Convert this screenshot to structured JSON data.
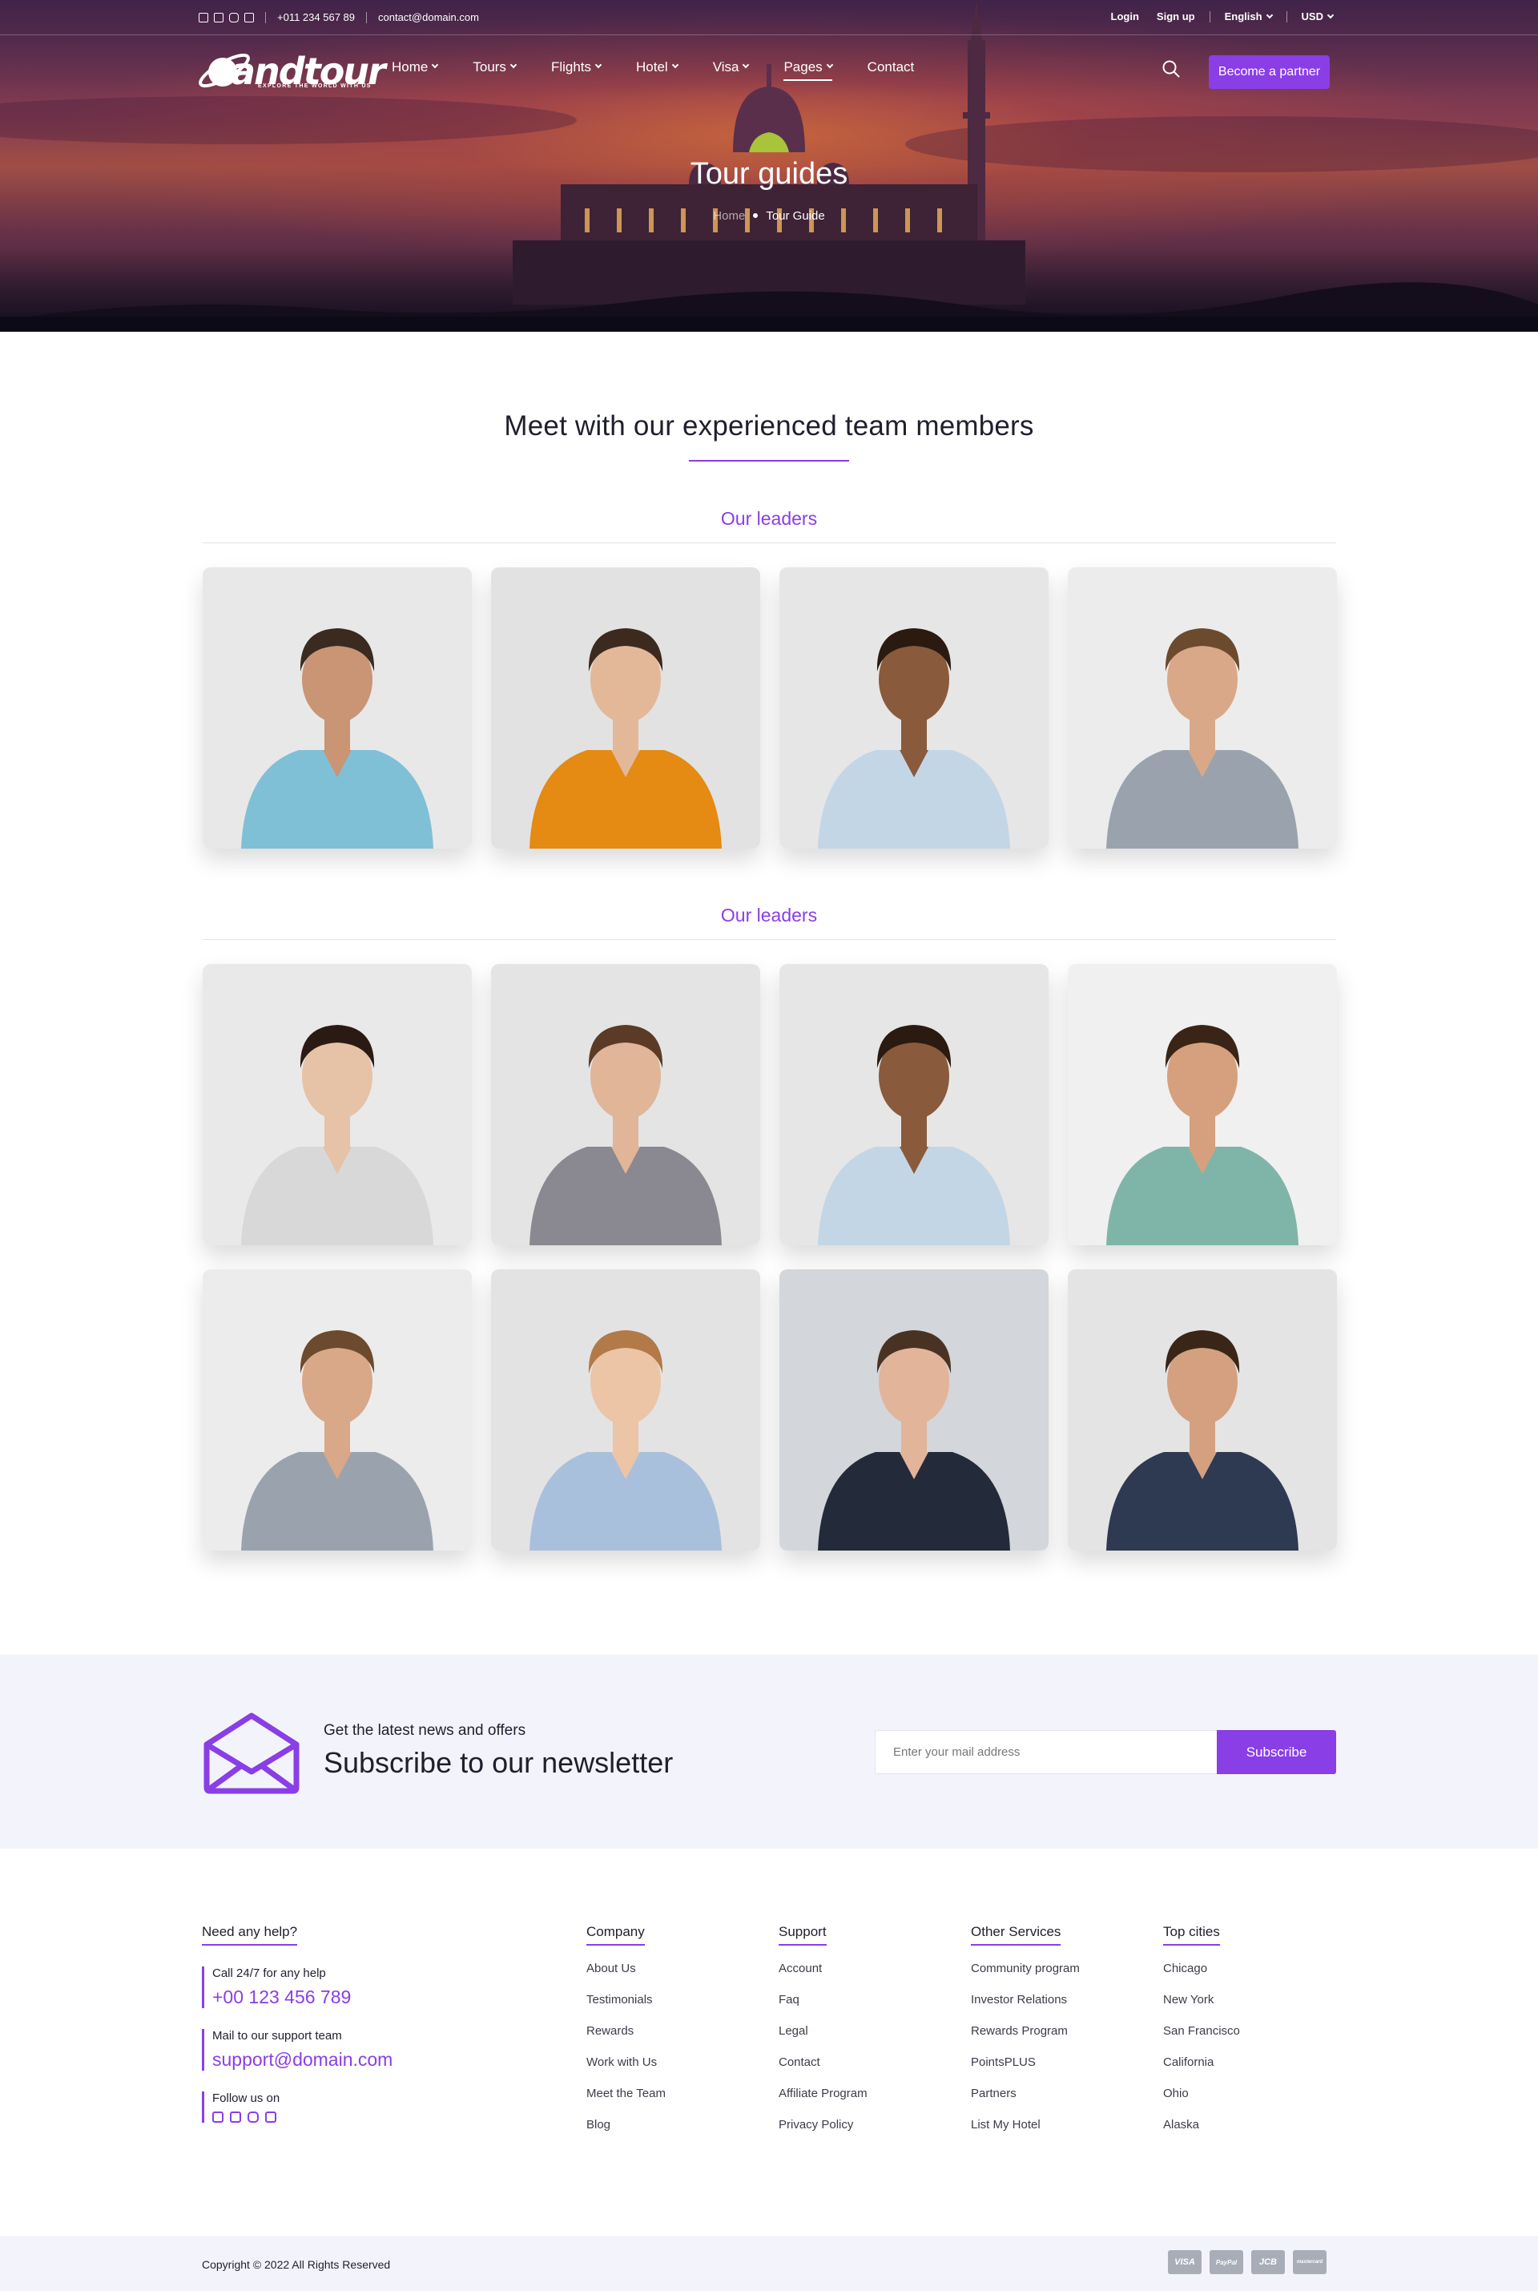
{
  "topbar": {
    "phone": "+011 234 567 89",
    "email": "contact@domain.com",
    "login": "Login",
    "signup": "Sign up",
    "language": "English",
    "currency": "USD"
  },
  "brand": {
    "name": "andtour",
    "tagline": "EXPLORE THE WORLD WITH US"
  },
  "nav": {
    "items": [
      {
        "label": "Home",
        "dropdown": true
      },
      {
        "label": "Tours",
        "dropdown": true
      },
      {
        "label": "Flights",
        "dropdown": true
      },
      {
        "label": "Hotel",
        "dropdown": true
      },
      {
        "label": "Visa",
        "dropdown": true
      },
      {
        "label": "Pages",
        "dropdown": true,
        "active": true
      },
      {
        "label": "Contact",
        "dropdown": false
      }
    ],
    "partner_button": "Become a partner"
  },
  "hero": {
    "title": "Tour guides",
    "breadcrumb_home": "Home",
    "breadcrumb_current": "Tour Guide"
  },
  "team": {
    "heading": "Meet with our experienced team members",
    "groups": [
      {
        "title": "Our leaders",
        "members": [
          {
            "skin": "#c99575",
            "hair": "#3a2a20",
            "shirt": "#7fc0d6",
            "bg": "#e8e8e8"
          },
          {
            "skin": "#e3b899",
            "hair": "#3d2a1e",
            "shirt": "#e58a12",
            "bg": "#e2e2e2"
          },
          {
            "skin": "#8a5a3c",
            "hair": "#2a1a10",
            "shirt": "#c3d6e6",
            "bg": "#e6e6e6"
          },
          {
            "skin": "#d8a888",
            "hair": "#6b4a2e",
            "shirt": "#9aa3ad",
            "bg": "#ececec"
          }
        ]
      },
      {
        "title": "Our leaders",
        "members": [
          {
            "skin": "#e6c2a6",
            "hair": "#2b1a14",
            "shirt": "#d8d8d8",
            "bg": "#e9e9ea"
          },
          {
            "skin": "#e0b598",
            "hair": "#5b3a26",
            "shirt": "#8a8890",
            "bg": "#e4e4e4"
          },
          {
            "skin": "#8a5a3c",
            "hair": "#2a1a10",
            "shirt": "#c3d6e6",
            "bg": "#e6e6e6"
          },
          {
            "skin": "#d6a07e",
            "hair": "#3a2416",
            "shirt": "#7fb5a8",
            "bg": "#f0f0f0"
          },
          {
            "skin": "#d8a888",
            "hair": "#6b4a2e",
            "shirt": "#9aa3ad",
            "bg": "#ececec"
          },
          {
            "skin": "#ecc4a6",
            "hair": "#b27a48",
            "shirt": "#a9c0dc",
            "bg": "#e3e3e3"
          },
          {
            "skin": "#e2b49a",
            "hair": "#4a3222",
            "shirt": "#232a3a",
            "bg": "#d3d6da"
          },
          {
            "skin": "#d4a080",
            "hair": "#3a2616",
            "shirt": "#2d3a52",
            "bg": "#e4e4e4"
          }
        ]
      }
    ]
  },
  "newsletter": {
    "kicker": "Get the latest news and offers",
    "headline": "Subscribe to our newsletter",
    "placeholder": "Enter your mail address",
    "button": "Subscribe"
  },
  "footer": {
    "help": {
      "title": "Need any help?",
      "call_label": "Call 24/7 for any help",
      "call_value": "+00 123 456 789",
      "mail_label": "Mail to our support team",
      "mail_value": "support@domain.com",
      "follow_label": "Follow us on"
    },
    "columns": [
      {
        "title": "Company",
        "links": [
          "About Us",
          "Testimonials",
          "Rewards",
          "Work with Us",
          "Meet the Team",
          "Blog"
        ]
      },
      {
        "title": "Support",
        "links": [
          "Account",
          "Faq",
          "Legal",
          "Contact",
          "Affiliate Program",
          "Privacy Policy"
        ]
      },
      {
        "title": "Other Services",
        "links": [
          "Community program",
          "Investor Relations",
          "Rewards Program",
          "PointsPLUS",
          "Partners",
          "List My Hotel"
        ]
      },
      {
        "title": "Top cities",
        "links": [
          "Chicago",
          "New York",
          "San Francisco",
          "California",
          "Ohio",
          "Alaska"
        ]
      }
    ],
    "copyright": "Copyright © 2022 All Rights Reserved",
    "payments": [
      "VISA",
      "PayPal",
      "JCB",
      "mastercard"
    ]
  },
  "colors": {
    "accent": "#8a3ee6",
    "newsletter_bg": "#f3f4fb"
  }
}
